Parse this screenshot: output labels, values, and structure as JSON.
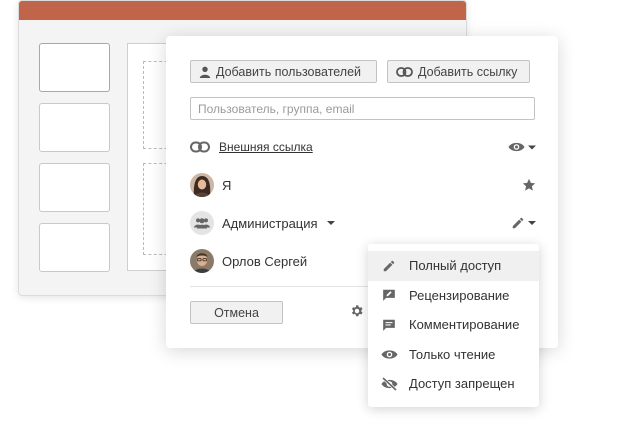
{
  "dialog": {
    "add_users_label": "Добавить пользователей",
    "add_link_label": "Добавить ссылку",
    "search_placeholder": "Пользователь, группа, email",
    "rows": [
      {
        "name": "Внешняя ссылка",
        "type": "link",
        "access_icon": "eye-icon"
      },
      {
        "name": "Я",
        "type": "user",
        "access_icon": "star-icon"
      },
      {
        "name": "Администрация",
        "type": "group",
        "access_icon": "pencil-icon"
      },
      {
        "name": "Орлов Сергей",
        "type": "user"
      }
    ],
    "cancel_label": "Отмена"
  },
  "access_menu": {
    "items": [
      {
        "label": "Полный доступ",
        "icon": "pencil-icon",
        "selected": true
      },
      {
        "label": "Рецензирование",
        "icon": "review-icon",
        "selected": false
      },
      {
        "label": "Комментирование",
        "icon": "comment-icon",
        "selected": false
      },
      {
        "label": "Только чтение",
        "icon": "eye-icon",
        "selected": false
      },
      {
        "label": "Доступ запрещен",
        "icon": "eye-off-icon",
        "selected": false
      }
    ]
  },
  "colors": {
    "header": "#c0644a",
    "icon": "#666666",
    "selected_item": "#f0f0f0"
  }
}
